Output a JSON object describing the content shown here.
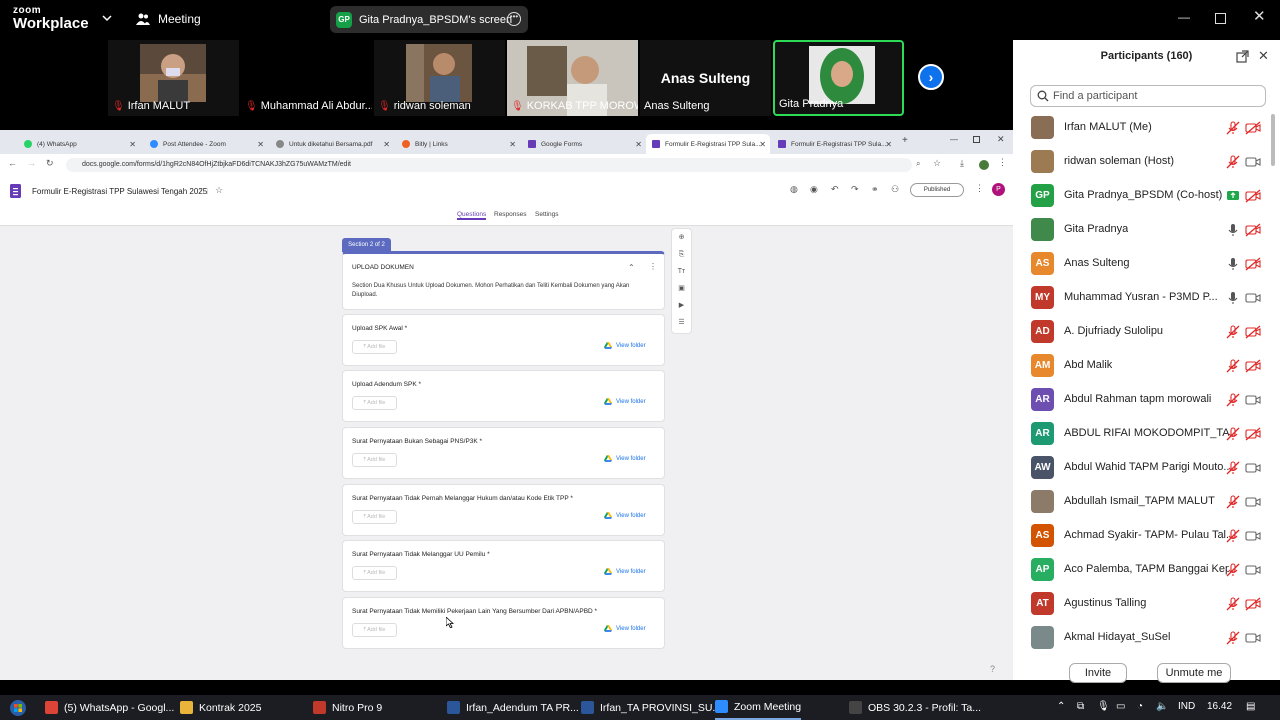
{
  "zoom": {
    "logo_line1": "zoom",
    "logo_line2": "Workplace",
    "meeting_label": "Meeting",
    "screen_pill": "Gita Pradnya_BPSDM's screen",
    "screen_badge": "GP"
  },
  "video_strip": [
    {
      "name": "Irfan MALUT",
      "muted": true
    },
    {
      "name": "Muhammad Ali Abdur...",
      "muted": true
    },
    {
      "name": "ridwan soleman",
      "muted": true
    },
    {
      "name": "KORKAB TPP MOROW...",
      "muted": true
    },
    {
      "name": "Anas Sulteng",
      "big_label": "Anas Sulteng",
      "muted": false
    },
    {
      "name": "Gita Pradnya",
      "muted": false,
      "active": true
    }
  ],
  "browser": {
    "tabs": [
      {
        "label": "(4) WhatsApp"
      },
      {
        "label": "Post Attendee - Zoom"
      },
      {
        "label": "Untuk diketahui Bersama.pdf"
      },
      {
        "label": "Bitly | Links"
      },
      {
        "label": "Google Forms"
      },
      {
        "label": "Formulir E-Registrasi TPP Sula..."
      },
      {
        "label": "Formulir E-Registrasi TPP Sula..."
      }
    ],
    "url": "docs.google.com/forms/d/1hgR2cN84OfHjZtbjkaFD6diTCNAKJ3hZG75uWAMzTM/edit"
  },
  "form": {
    "title": "Formulir E-Registrasi TPP Sulawesi Tengah 2025",
    "tab_questions": "Questions",
    "tab_responses": "Responses",
    "tab_settings": "Settings",
    "publish_label": "Published",
    "avatar": "P",
    "section_label": "Section 2 of 2",
    "section_title": "UPLOAD DOKUMEN",
    "section_desc": "Section Dua Khusus Untuk Upload Dokumen. Mohon Perhatikan dan Teliti Kembali Dokumen yang Akan Diupload.",
    "add_file": "Add file",
    "view_folder": "View folder",
    "questions": [
      "Upload SPK Awal *",
      "Upload Adendum SPK *",
      "Surat Pernyataan Bukan Sebagai PNS/P3K *",
      "Surat Pernyataan Tidak Pernah Melanggar Hukum dan/atau Kode Etik TPP *",
      "Surat Pernyataan Tidak Melanggar UU Pemilu *",
      "Surat Pernyataan Tidak Memiliki Pekerjaan Lain Yang Bersumber Dari APBN/APBD *"
    ]
  },
  "participants": {
    "title": "Participants (160)",
    "search_placeholder": "Find a participant",
    "list": [
      {
        "name": "Irfan MALUT (Me)",
        "initials": "",
        "color": "#8a6d55",
        "mic": "muted",
        "video": "off"
      },
      {
        "name": "ridwan soleman (Host)",
        "initials": "",
        "color": "#9c7a52",
        "mic": "muted",
        "video": "on"
      },
      {
        "name": "Gita Pradnya_BPSDM (Co-host)",
        "initials": "GP",
        "color": "#24a147",
        "mic": "share",
        "video": "off"
      },
      {
        "name": "Gita Pradnya",
        "initials": "",
        "color": "#3f8a4a",
        "mic": "on",
        "video": "off"
      },
      {
        "name": "Anas Sulteng",
        "initials": "AS",
        "color": "#e8882c",
        "mic": "on",
        "video": "off"
      },
      {
        "name": "Muhammad Yusran - P3MD P...",
        "initials": "MY",
        "color": "#c0392b",
        "mic": "on",
        "video": "on"
      },
      {
        "name": "A. Djufriady Sulolipu",
        "initials": "AD",
        "color": "#c0392b",
        "mic": "muted",
        "video": "off"
      },
      {
        "name": "Abd Malik",
        "initials": "AM",
        "color": "#e8882c",
        "mic": "muted",
        "video": "off"
      },
      {
        "name": "Abdul Rahman tapm morowali",
        "initials": "AR",
        "color": "#6c4fb0",
        "mic": "muted",
        "video": "on"
      },
      {
        "name": "ABDUL RIFAI MOKODOMPIT_TA...",
        "initials": "AR",
        "color": "#1e9a73",
        "mic": "muted",
        "video": "off"
      },
      {
        "name": "Abdul Wahid TAPM Parigi Mouto...",
        "initials": "AW",
        "color": "#4a5468",
        "mic": "muted",
        "video": "on"
      },
      {
        "name": "Abdullah Ismail_TAPM MALUT",
        "initials": "",
        "color": "#8d7b6a",
        "mic": "muted",
        "video": "on"
      },
      {
        "name": "Achmad Syakir- TAPM- Pulau Tal...",
        "initials": "AS",
        "color": "#d35400",
        "mic": "muted",
        "video": "on"
      },
      {
        "name": "Aco Palemba, TAPM Banggai Kep...",
        "initials": "AP",
        "color": "#27ae60",
        "mic": "muted",
        "video": "on"
      },
      {
        "name": "Agustinus Talling",
        "initials": "AT",
        "color": "#c0392b",
        "mic": "muted",
        "video": "off"
      },
      {
        "name": "Akmal Hidayat_SuSel",
        "initials": "",
        "color": "#7a8a8a",
        "mic": "muted",
        "video": "on"
      }
    ],
    "invite_label": "Invite",
    "unmute_label": "Unmute me"
  },
  "taskbar": {
    "apps": [
      {
        "label": "(5) WhatsApp - Googl...",
        "color": "#db4437"
      },
      {
        "label": "Kontrak 2025",
        "color": "#e8b43a"
      },
      {
        "label": "Nitro Pro 9",
        "color": "#c0392b"
      },
      {
        "label": "Irfan_Adendum TA PR...",
        "color": "#2b579a"
      },
      {
        "label": "Irfan_TA PROVINSI_SU...",
        "color": "#2b579a"
      },
      {
        "label": "Zoom Meeting",
        "color": "#2d8cff"
      },
      {
        "label": "OBS 30.2.3 - Profil: Ta...",
        "color": "#444"
      }
    ],
    "lang": "IND",
    "time": "16.42"
  }
}
